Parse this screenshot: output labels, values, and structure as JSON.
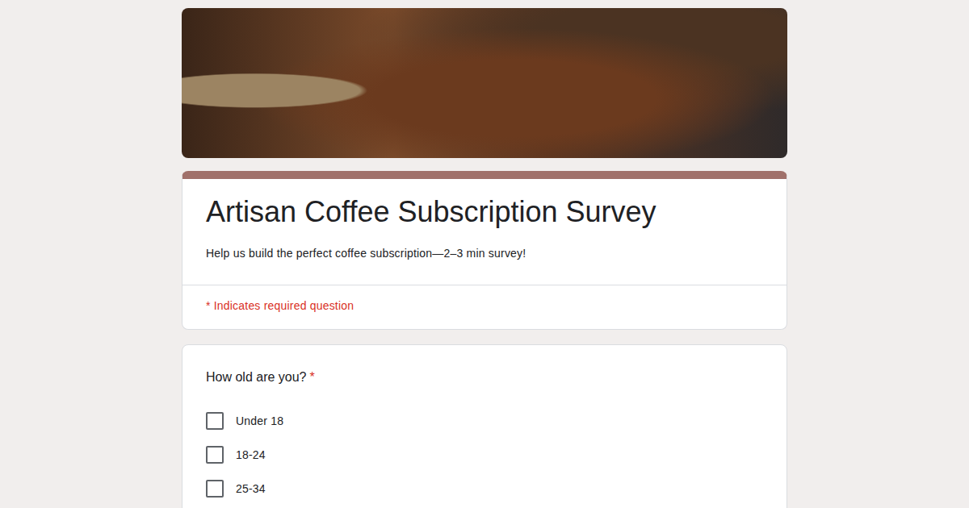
{
  "form": {
    "title": "Artisan Coffee Subscription Survey",
    "description": "Help us build the perfect coffee subscription—2–3 min survey!",
    "required_note": "* Indicates required question"
  },
  "questions": [
    {
      "title": "How old are you?",
      "required_mark": "*",
      "options": [
        {
          "label": "Under 18",
          "checked": false
        },
        {
          "label": "18-24",
          "checked": false
        },
        {
          "label": "25-34",
          "checked": false
        }
      ]
    }
  ]
}
